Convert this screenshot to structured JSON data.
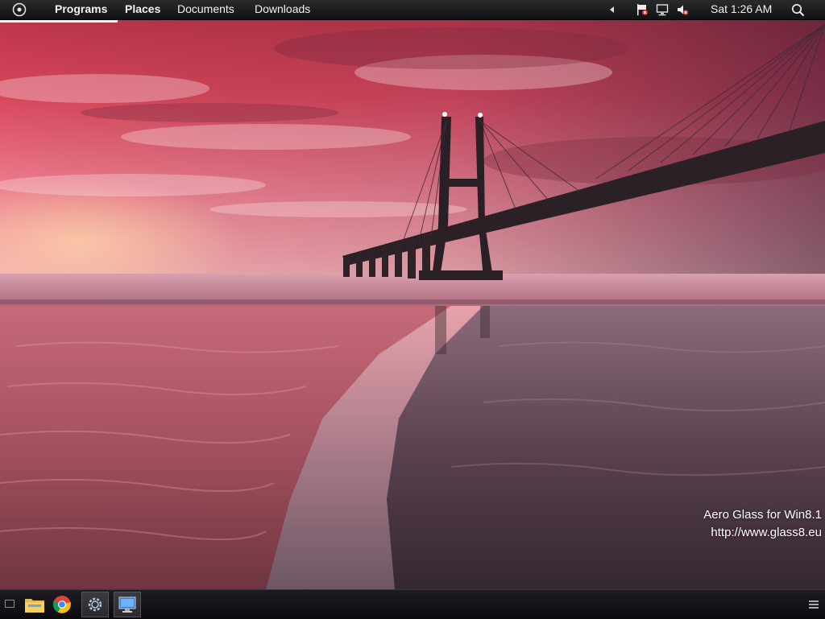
{
  "top_panel": {
    "menu_items": {
      "programs": "Programs",
      "places": "Places",
      "documents": "Documents",
      "downloads": "Downloads"
    },
    "clock": "Sat 1:26 AM",
    "tray_icons": [
      "arrow-left-icon",
      "action-center-flag-icon",
      "network-icon",
      "volume-muted-icon"
    ],
    "search_icon": "search-icon"
  },
  "watermark": {
    "line1": "Aero Glass for Win8.1",
    "line2": "http://www.glass8.eu"
  },
  "taskbar": {
    "buttons": [
      "show-desktop-icon",
      "file-explorer-icon",
      "chrome-icon",
      "settings-gear-icon",
      "remote-desktop-icon",
      "taskbar-menu-icon"
    ]
  },
  "colors": {
    "sky_top": "#c2364a",
    "sky_horizon": "#f29aa6",
    "water": "#b45d6e",
    "panel": "#1a1a1c"
  }
}
